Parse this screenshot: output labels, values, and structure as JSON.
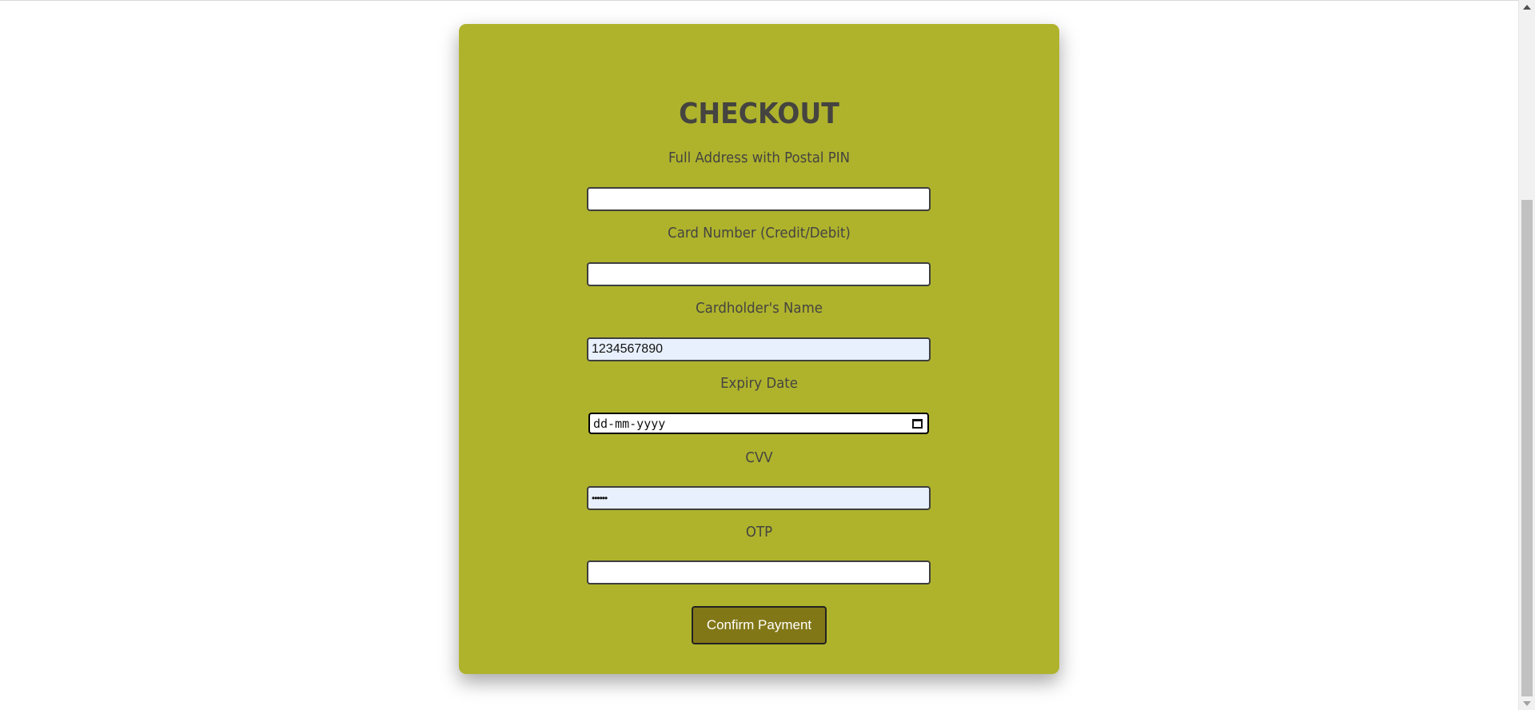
{
  "checkout": {
    "title": "CHECKOUT",
    "fields": [
      {
        "label": "Full Address with Postal PIN",
        "value": ""
      },
      {
        "label": "Card Number (Credit/Debit)",
        "value": ""
      },
      {
        "label": "Cardholder's Name",
        "value": "1234567890"
      },
      {
        "label": "Expiry Date",
        "value": "dd-mm-yyyy"
      },
      {
        "label": "CVV",
        "value": "••••••"
      },
      {
        "label": "OTP",
        "value": ""
      }
    ],
    "submit_label": "Confirm Payment"
  },
  "colors": {
    "card_background": "#afb32c",
    "button_background": "#827717",
    "autofill_background": "#e8f0fe",
    "text": "#454440"
  },
  "icons": {
    "expiry_picker": "calendar-icon",
    "scroll_up": "scroll-up-arrow-icon",
    "scroll_down": "scroll-down-arrow-icon"
  }
}
